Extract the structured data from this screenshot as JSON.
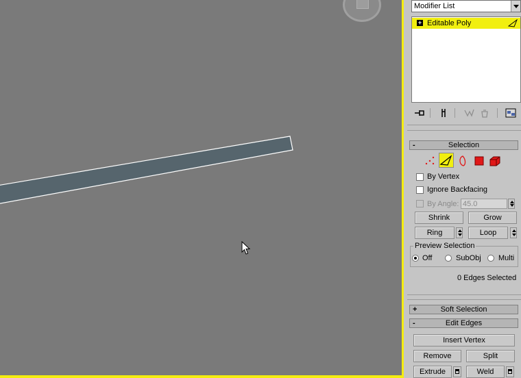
{
  "modifier_list": {
    "label": "Modifier List"
  },
  "stack": {
    "item_label": "Editable Poly"
  },
  "selection": {
    "title": "Selection",
    "collapse_sign": "-",
    "by_vertex": "By Vertex",
    "ignore_backfacing": "Ignore Backfacing",
    "by_angle": "By Angle:",
    "angle_value": "45.0",
    "shrink": "Shrink",
    "grow": "Grow",
    "ring": "Ring",
    "loop": "Loop",
    "preview_title": "Preview Selection",
    "preview_off": "Off",
    "preview_subobj": "SubObj",
    "preview_multi": "Multi",
    "status": "0 Edges Selected"
  },
  "soft_selection": {
    "title": "Soft Selection",
    "sign": "+"
  },
  "edit_edges": {
    "title": "Edit Edges",
    "sign": "-",
    "insert_vertex": "Insert Vertex",
    "remove": "Remove",
    "split": "Split",
    "extrude": "Extrude",
    "weld": "Weld"
  },
  "colors": {
    "viewport_bg": "#7a7a7a",
    "active_border": "#f4ec10",
    "panel_bg": "#c5c5c5",
    "beam_fill": "#56656d",
    "highlight": "#f1ef10"
  },
  "icons": {
    "subobject_levels": [
      "vertex-icon",
      "edge-icon",
      "border-icon",
      "polygon-icon",
      "element-icon"
    ],
    "stack_toolbar": [
      "pin-stack-icon",
      "show-end-result-icon",
      "make-unique-icon",
      "remove-modifier-icon",
      "configure-sets-icon"
    ]
  }
}
